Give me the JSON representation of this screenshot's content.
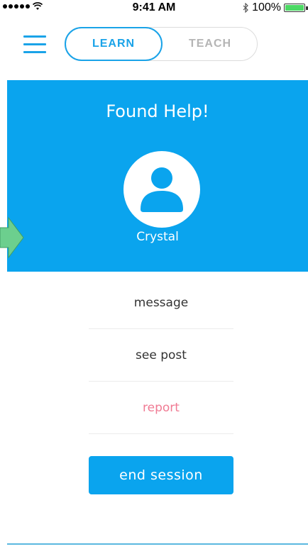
{
  "status_bar": {
    "time": "9:41 AM",
    "battery_text": "100%",
    "battery_level": 1.0
  },
  "header": {
    "tabs": [
      {
        "label": "LEARN",
        "selected": true
      },
      {
        "label": "TEACH",
        "selected": false
      }
    ]
  },
  "panel": {
    "title": "Found Help!",
    "helper_name": "Crystal"
  },
  "actions": [
    {
      "label": "message"
    },
    {
      "label": "see post"
    },
    {
      "label": "report"
    }
  ],
  "end_button_label": "end session",
  "icons": {
    "menu": "hamburger-menu-icon",
    "avatar": "person-avatar-icon",
    "arrow": "right-arrow-icon"
  },
  "colors": {
    "accent": "#0aa4ee",
    "menu_icon": "#1aa3e8",
    "report": "#f07a93",
    "arrow": "#6ccf8e",
    "inactive_tab": "#b5b5b5"
  }
}
